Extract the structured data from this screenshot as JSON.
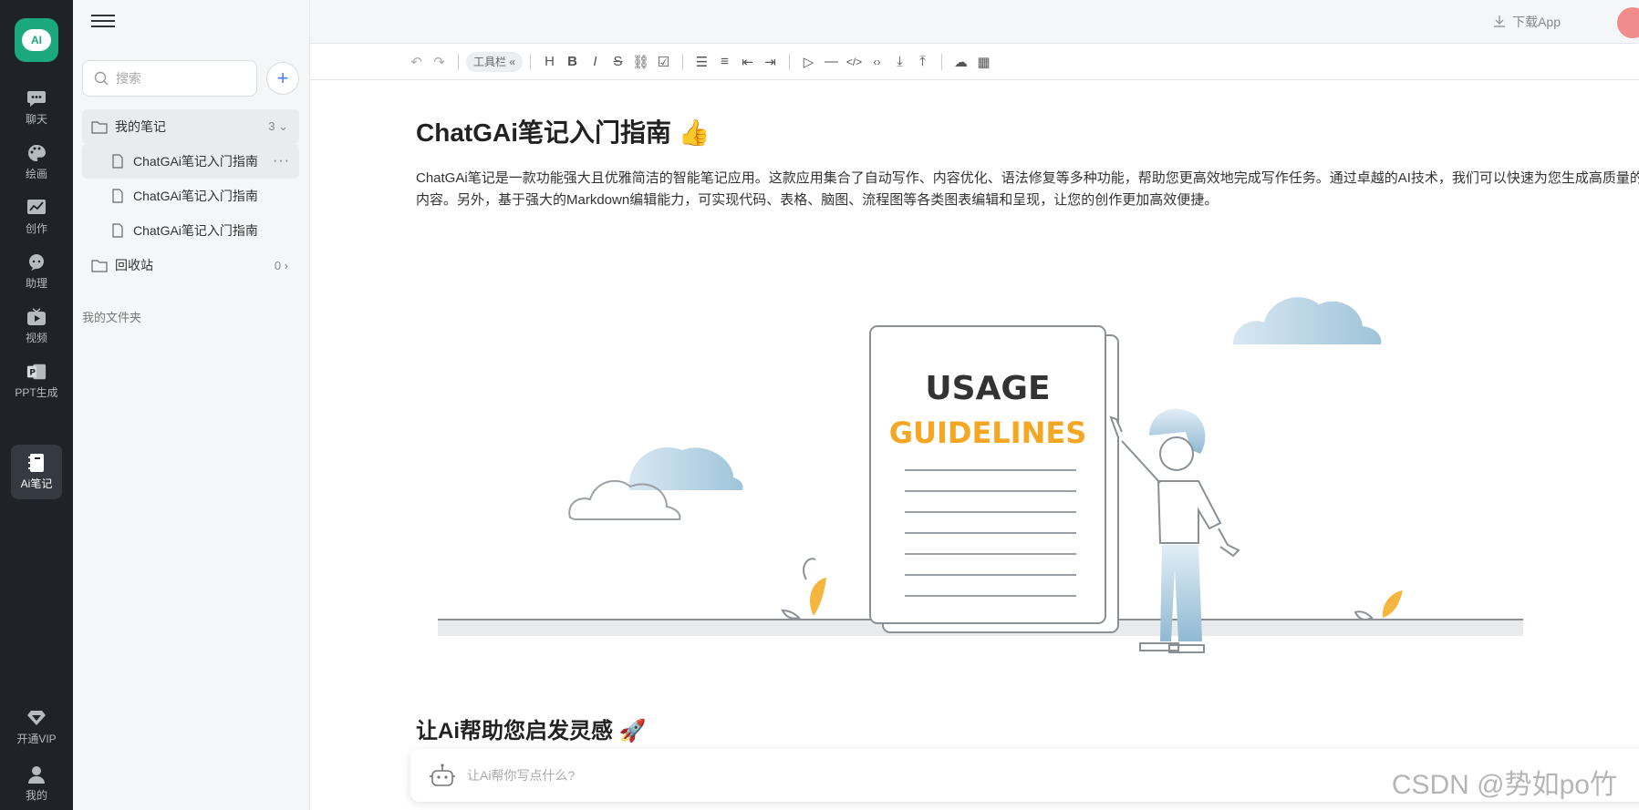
{
  "app": {
    "logo_text": "AI"
  },
  "rail": {
    "items": [
      {
        "label": "聊天",
        "icon": "chat-icon"
      },
      {
        "label": "绘画",
        "icon": "palette-icon"
      },
      {
        "label": "创作",
        "icon": "chart-icon"
      },
      {
        "label": "助理",
        "icon": "assistant-icon"
      },
      {
        "label": "视频",
        "icon": "video-icon"
      },
      {
        "label": "PPT生成",
        "icon": "ppt-icon"
      },
      {
        "label": "Ai笔记",
        "icon": "notebook-icon",
        "active": true
      }
    ],
    "bottom": [
      {
        "label": "开通VIP",
        "icon": "diamond-icon"
      },
      {
        "label": "我的",
        "icon": "user-icon"
      }
    ]
  },
  "sidebar": {
    "search_placeholder": "搜索",
    "add_label": "+",
    "tree": [
      {
        "label": "我的笔记",
        "count": "3",
        "type": "folder"
      },
      {
        "label": "ChatGAi笔记入门指南",
        "type": "note",
        "more": "···"
      },
      {
        "label": "ChatGAi笔记入门指南",
        "type": "note"
      },
      {
        "label": "ChatGAi笔记入门指南",
        "type": "note"
      },
      {
        "label": "回收站",
        "count": "0",
        "type": "folder"
      }
    ],
    "folder_section": "我的文件夹"
  },
  "header": {
    "download_label": "下载App"
  },
  "toolbar": {
    "pill_label": "工具栏 «"
  },
  "document": {
    "title": "ChatGAi笔记入门指南",
    "paragraph": "ChatGAi笔记是一款功能强大且优雅简洁的智能笔记应用。这款应用集合了自动写作、内容优化、语法修复等多种功能，帮助您更高效地完成写作任务。通过卓越的AI技术，我们可以快速为您生成高质量的内容。另外，基于强大的Markdown编辑能力，可实现代码、表格、脑图、流程图等各类图表编辑和呈现，让您的创作更加高效便捷。",
    "illustration": {
      "line1": "USAGE",
      "line2": "GUIDELINES"
    },
    "section2_title": "让Ai帮助您启发灵感"
  },
  "ai_bar": {
    "placeholder": "让Ai帮你写点什么?"
  },
  "watermark": "CSDN @势如po竹",
  "colors": {
    "accent": "#1aa87c",
    "rail_bg": "#1f2329",
    "guidelines_orange": "#f5a623"
  }
}
